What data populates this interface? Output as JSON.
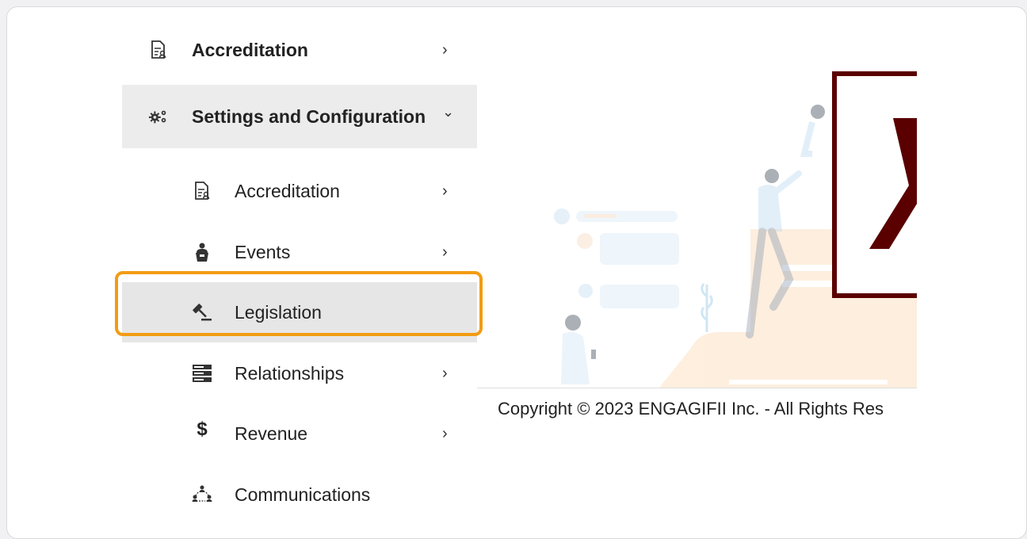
{
  "menu": {
    "items": [
      {
        "label": "Accreditation",
        "icon": "document-user-icon",
        "chevron": "›"
      },
      {
        "label": "Settings and Configuration",
        "icon": "gears-icon",
        "chevron": "⌄"
      }
    ],
    "sub_items": [
      {
        "label": "Accreditation",
        "icon": "document-user-icon",
        "chevron": "›"
      },
      {
        "label": "Events",
        "icon": "speaker-podium-icon",
        "chevron": "›"
      },
      {
        "label": "Legislation",
        "icon": "gavel-icon",
        "chevron": ""
      },
      {
        "label": "Relationships",
        "icon": "server-stack-icon",
        "chevron": "›"
      },
      {
        "label": "Revenue",
        "icon": "dollar-icon",
        "chevron": "›"
      },
      {
        "label": "Communications",
        "icon": "network-people-icon",
        "chevron": ""
      }
    ]
  },
  "footer": {
    "copyright": "Copyright © 2023 ENGAGIFII Inc. - All Rights Res"
  },
  "colors": {
    "highlight": "#f39c12",
    "brand": "#5a0000"
  }
}
